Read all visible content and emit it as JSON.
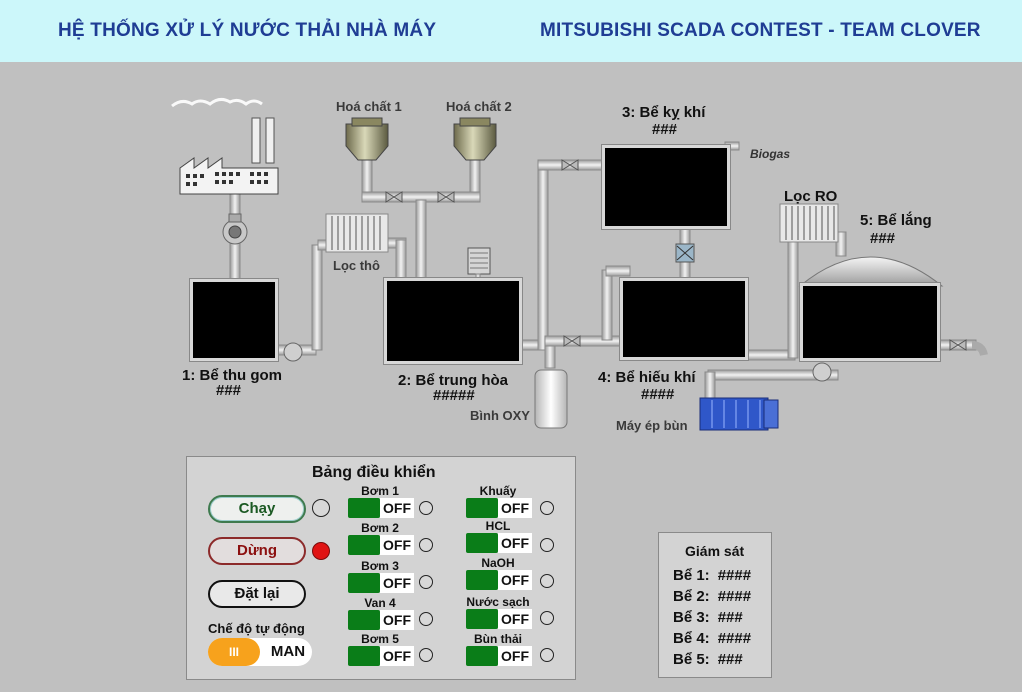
{
  "header": {
    "left_title": "HỆ THỐNG XỬ LÝ NƯỚC THẢI NHÀ MÁY",
    "right_title": "MITSUBISHI SCADA CONTEST - TEAM CLOVER"
  },
  "process": {
    "chem1": "Hoá chất 1",
    "chem2": "Hoá chất 2",
    "coarse_filter": "Lọc thô",
    "ro_filter": "Lọc RO",
    "biogas": "Biogas",
    "oxygen_tank": "Bình OXY",
    "sludge_press": "Máy ép bùn",
    "tanks": [
      {
        "name": "1: Bể thu gom",
        "value": "###"
      },
      {
        "name": "2: Bể trung hòa",
        "value": "#####"
      },
      {
        "name": "3: Bể kỵ khí",
        "value": "###"
      },
      {
        "name": "4: Bể hiếu khí",
        "value": "####"
      },
      {
        "name": "5: Bể lắng",
        "value": "###"
      }
    ]
  },
  "control": {
    "title": "Bảng điều khiển",
    "run": "Chạy",
    "stop": "Dừng",
    "reset": "Đặt lại",
    "auto_label": "Chế độ tự động",
    "auto_knob": "III",
    "auto_state": "MAN",
    "left_switches": [
      {
        "name": "Bơm 1",
        "state": "OFF"
      },
      {
        "name": "Bơm 2",
        "state": "OFF"
      },
      {
        "name": "Bơm 3",
        "state": "OFF"
      },
      {
        "name": "Van 4",
        "state": "OFF"
      },
      {
        "name": "Bơm 5",
        "state": "OFF"
      }
    ],
    "right_switches": [
      {
        "name": "Khuấy",
        "state": "OFF"
      },
      {
        "name": "HCL",
        "state": "OFF"
      },
      {
        "name": "NaOH",
        "state": "OFF"
      },
      {
        "name": "Nước sạch",
        "state": "OFF"
      },
      {
        "name": "Bùn thải",
        "state": "OFF"
      }
    ]
  },
  "monitor": {
    "title": "Giám sát",
    "rows": [
      {
        "label": "Bể 1:",
        "value": "####"
      },
      {
        "label": "Bể 2:",
        "value": "####"
      },
      {
        "label": "Bể 3:",
        "value": "###"
      },
      {
        "label": "Bể 4:",
        "value": "####"
      },
      {
        "label": "Bể 5:",
        "value": "###"
      }
    ]
  }
}
